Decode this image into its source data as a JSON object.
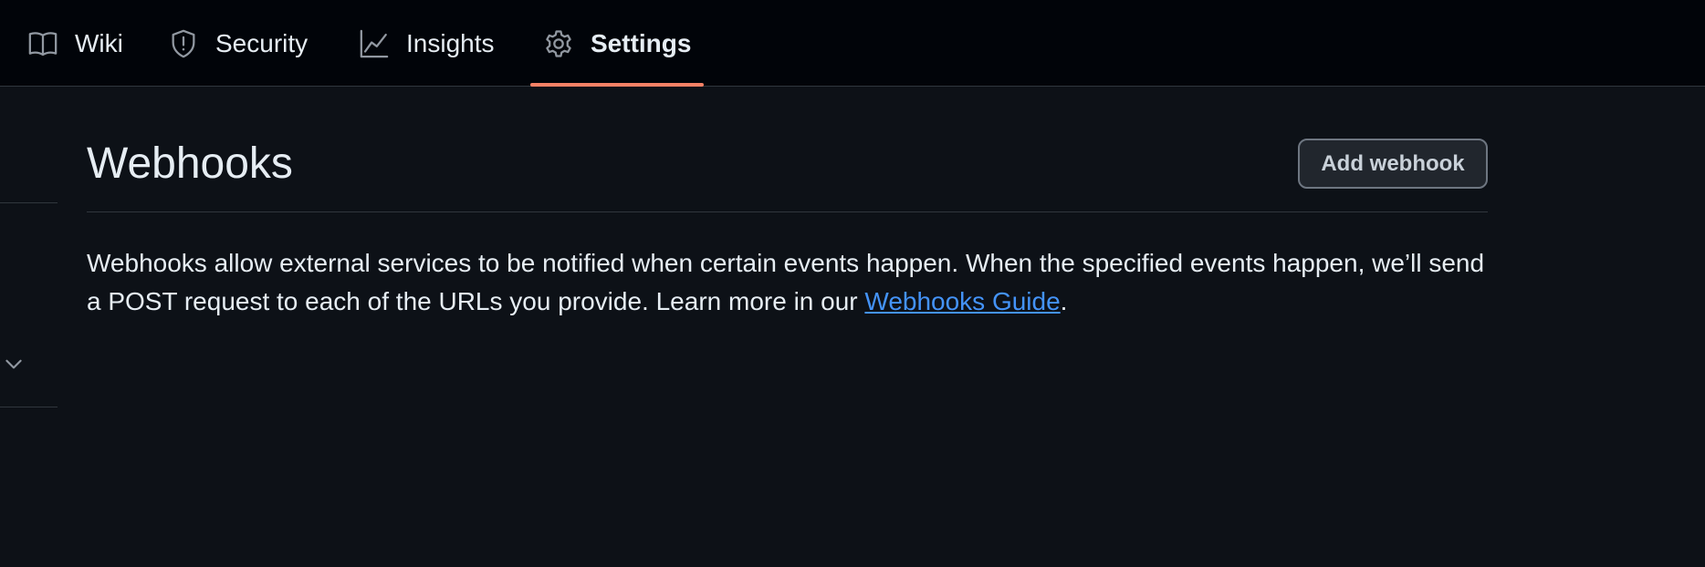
{
  "nav": {
    "tabs": [
      {
        "label": "Wiki",
        "icon": "book-icon",
        "active": false
      },
      {
        "label": "Security",
        "icon": "shield-icon",
        "active": false
      },
      {
        "label": "Insights",
        "icon": "graph-icon",
        "active": false
      },
      {
        "label": "Settings",
        "icon": "gear-icon",
        "active": true
      }
    ],
    "active_underline_color": "#f78166"
  },
  "sidebar": {
    "collapse_icon": "chevron-down-icon"
  },
  "main": {
    "title": "Webhooks",
    "add_button_label": "Add webhook",
    "description_before": "Webhooks allow external services to be notified when certain events happen. When the specified events happen, we’ll send a POST request to each of the URLs you provide. Learn more in our ",
    "guide_link_label": "Webhooks Guide",
    "description_after": "."
  },
  "colors": {
    "background": "#0d1117",
    "header_background": "#010409",
    "link": "#4493f8"
  }
}
